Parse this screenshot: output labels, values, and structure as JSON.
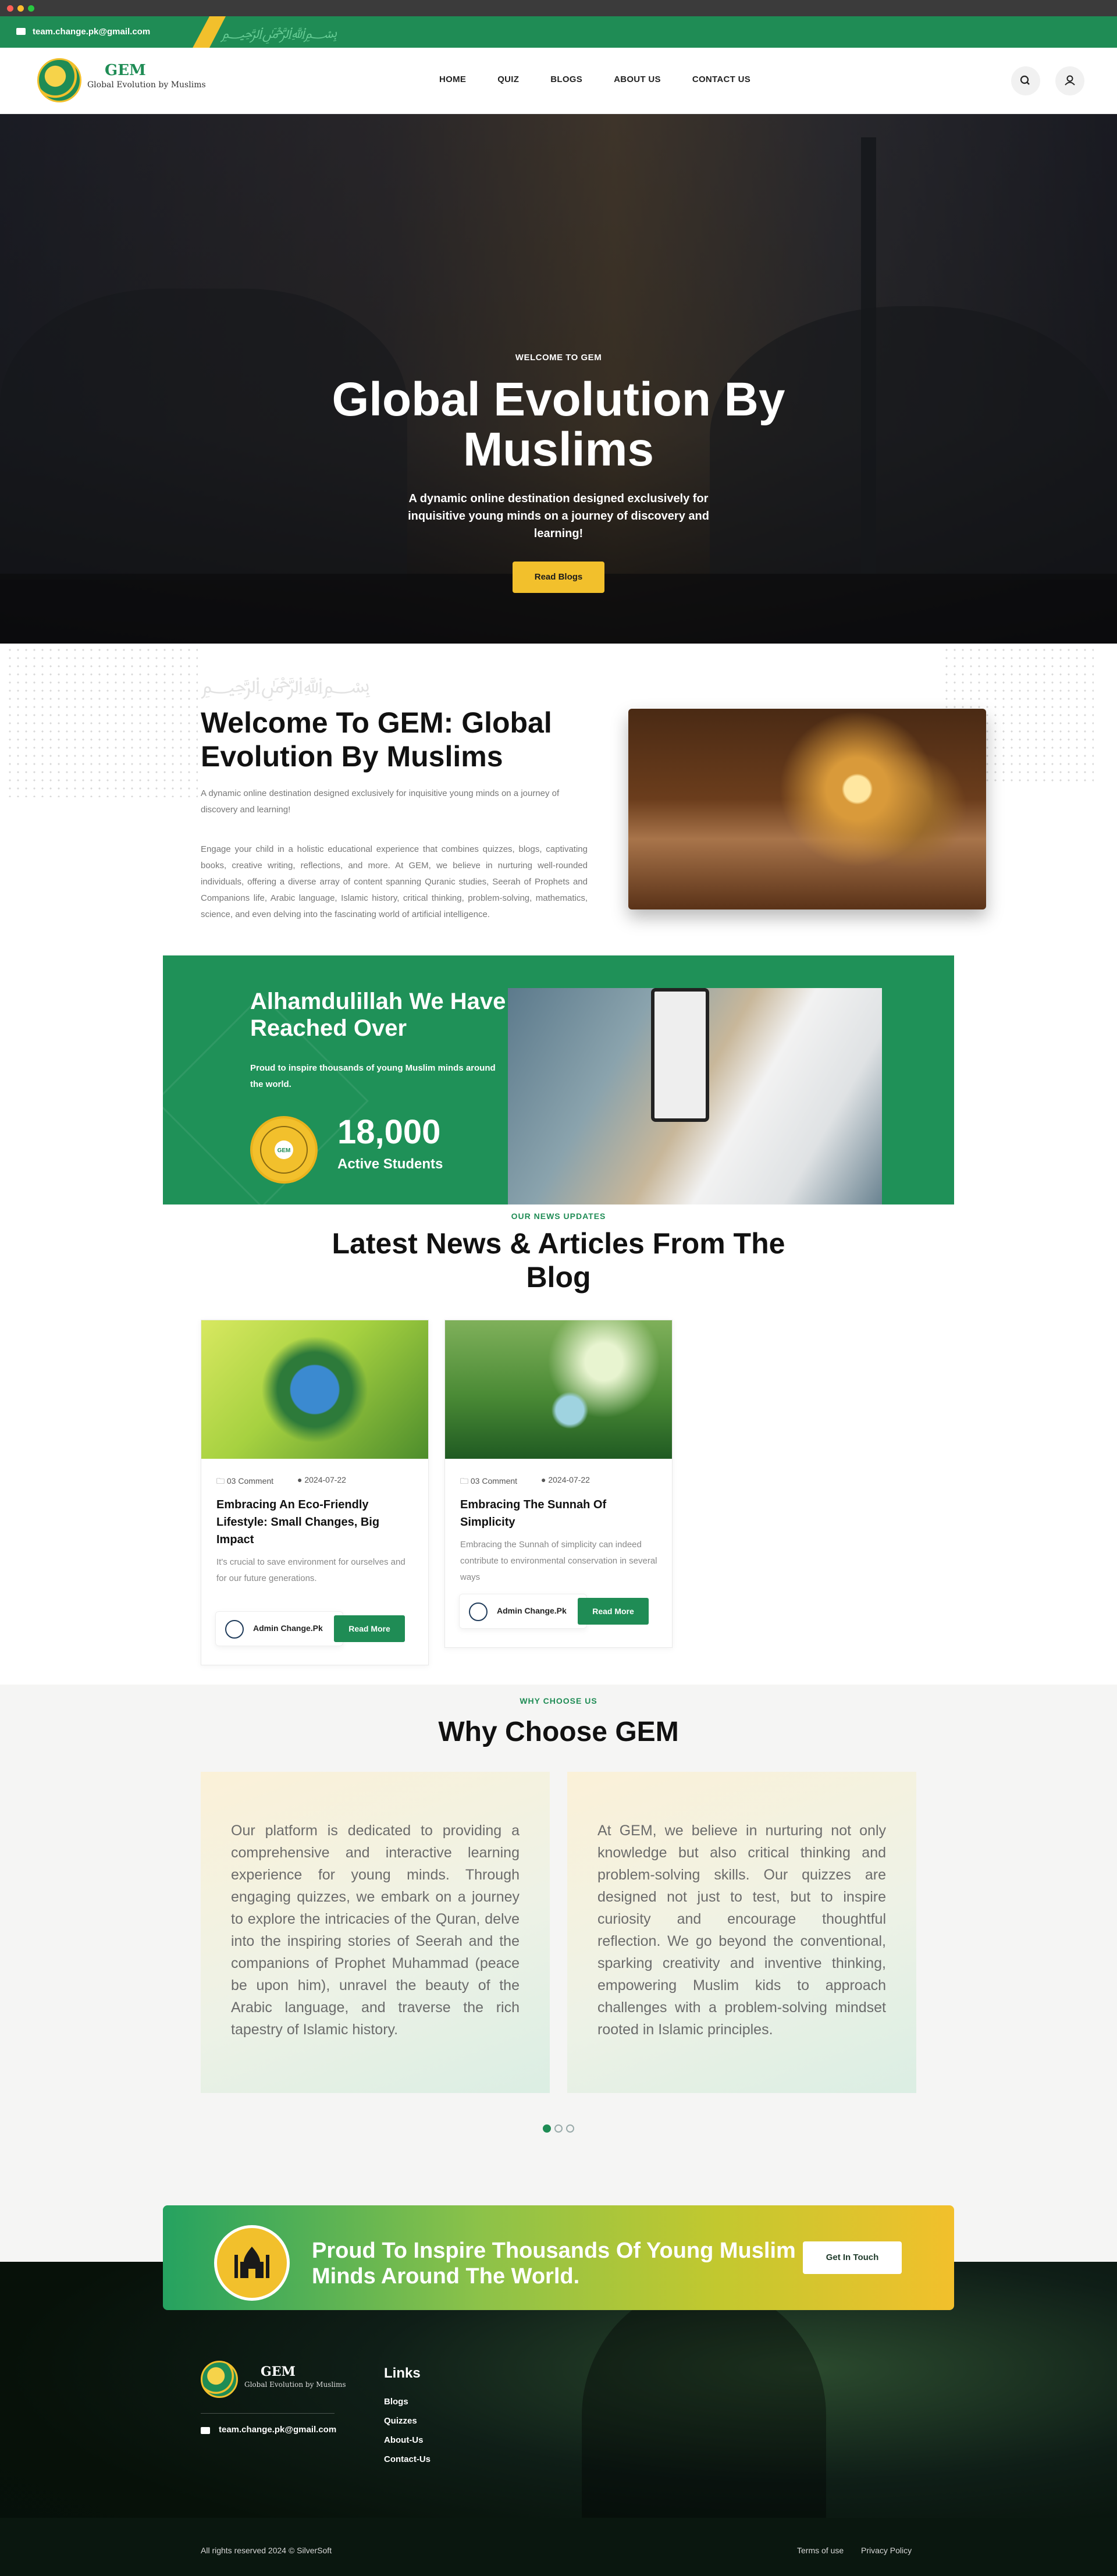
{
  "brand": {
    "accent": "#1f8c55",
    "yellow": "#f2c02c"
  },
  "topbar": {
    "email": "team.change.pk@gmail.com"
  },
  "logo": {
    "title": "GEM",
    "subtitle": "Global Evolution by Muslims"
  },
  "nav": {
    "items": [
      "HOME",
      "QUIZ",
      "BLOGS",
      "ABOUT US",
      "CONTACT US"
    ]
  },
  "hero": {
    "kicker": "WELCOME TO GEM",
    "title": "Global Evolution By Muslims",
    "description": "A dynamic online destination designed exclusively for inquisitive young minds on a journey of discovery and learning!",
    "button": "Read Blogs"
  },
  "welcome": {
    "title": "Welcome To GEM: Global Evolution By Muslims",
    "lead": "A dynamic online destination designed exclusively for inquisitive young minds on a journey of discovery and learning!",
    "body": "Engage your child in a holistic educational experience that combines quizzes, blogs, captivating books, creative writing, reflections, and more. At GEM, we believe in nurturing well-rounded individuals, offering a diverse array of content spanning Quranic studies, Seerah of Prophets and Companions life, Arabic language, Islamic history, critical thinking, problem-solving, mathematics, science, and even delving into the fascinating world of artificial intelligence."
  },
  "stats": {
    "title": "Alhamdulillah We Have Reached Over",
    "description": "Proud to inspire thousands of young Muslim minds around the world.",
    "number": "18,000",
    "label": "Active Students"
  },
  "blog": {
    "kicker": "OUR NEWS UPDATES",
    "title": "Latest News & Articles From The Blog",
    "cards": [
      {
        "comments": "03 Comment",
        "date": "2024-07-22",
        "title": "Embracing An Eco-Friendly Lifestyle: Small Changes, Big Impact",
        "description": "It's crucial to save environment for ourselves and for our future generations.",
        "author": "Admin Change.Pk",
        "button": "Read More"
      },
      {
        "comments": "03 Comment",
        "date": "2024-07-22",
        "title": "Embracing The Sunnah Of Simplicity",
        "description": "Embracing the Sunnah of simplicity can indeed contribute to environmental conservation in several ways",
        "author": "Admin Change.Pk",
        "button": "Read More"
      }
    ]
  },
  "why": {
    "kicker": "WHY CHOOSE US",
    "title": "Why Choose GEM",
    "cards": [
      "Our platform is dedicated to providing a comprehensive and interactive learning experience for young minds. Through engaging quizzes, we embark on a journey to explore the intricacies of the Quran, delve into the inspiring stories of Seerah and the companions of Prophet Muhammad (peace be upon him), unravel the beauty of the Arabic language, and traverse the rich tapestry of Islamic history.",
      "At GEM, we believe in nurturing not only knowledge but also critical thinking and problem-solving skills. Our quizzes are designed not just to test, but to inspire curiosity and encourage thoughtful reflection. We go beyond the conventional, sparking creativity and inventive thinking, empowering Muslim kids to approach challenges with a problem-solving mindset rooted in Islamic principles."
    ]
  },
  "cta": {
    "text": "Proud To Inspire Thousands Of Young Muslim Minds Around The World.",
    "button": "Get In Touch"
  },
  "footer": {
    "email": "team.change.pk@gmail.com",
    "links_heading": "Links",
    "links": [
      "Blogs",
      "Quizzes",
      "About-Us",
      "Contact-Us"
    ],
    "copyright": "All rights reserved 2024 © SilverSoft",
    "terms": "Terms of use",
    "privacy": "Privacy Policy"
  }
}
